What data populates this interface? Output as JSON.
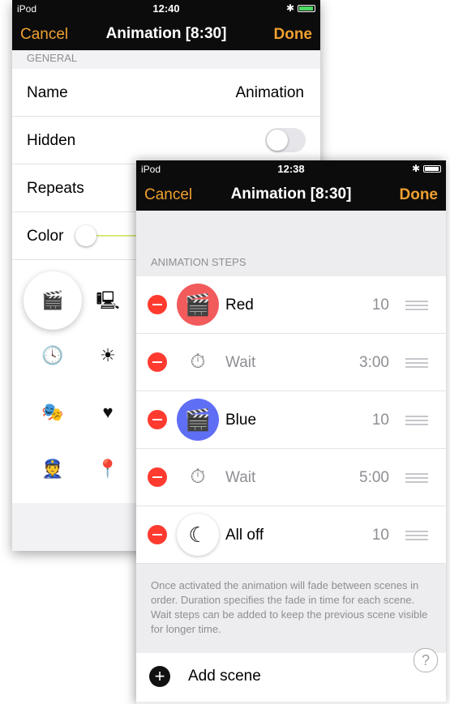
{
  "back": {
    "status": {
      "carrier": "iPod",
      "time": "12:40"
    },
    "nav": {
      "cancel": "Cancel",
      "title": "Animation [8:30]",
      "done": "Done"
    },
    "section": "GENERAL",
    "rows": {
      "name_label": "Name",
      "name_value": "Animation",
      "hidden_label": "Hidden",
      "repeats_label": "Repeats",
      "color_label": "Color"
    },
    "icons": [
      "scene-icon",
      "screen-icon",
      "clock-icon",
      "sun-icon",
      "mask-icon",
      "heart-icon",
      "person-icon",
      "location-icon"
    ]
  },
  "front": {
    "status": {
      "carrier": "iPod",
      "time": "12:38"
    },
    "nav": {
      "cancel": "Cancel",
      "title": "Animation [8:30]",
      "done": "Done"
    },
    "section": "ANIMATION STEPS",
    "steps": [
      {
        "name": "Red",
        "duration": "10",
        "icon": "scene-icon",
        "color": "#f25b5b"
      },
      {
        "name": "Wait",
        "duration": "3:00",
        "icon": "stopwatch-icon"
      },
      {
        "name": "Blue",
        "duration": "10",
        "icon": "scene-icon",
        "color": "#5e6ef5"
      },
      {
        "name": "Wait",
        "duration": "5:00",
        "icon": "stopwatch-icon"
      },
      {
        "name": "All off",
        "duration": "10",
        "icon": "moon-icon"
      }
    ],
    "footer": "Once activated the animation will fade between scenes in order. Duration specifies the fade in time for each scene. Wait steps can be added to keep the previous scene visible for longer time.",
    "add_label": "Add scene",
    "help": "?"
  },
  "colors": {
    "accent": "#f0a030",
    "delete": "#ff3b30"
  }
}
